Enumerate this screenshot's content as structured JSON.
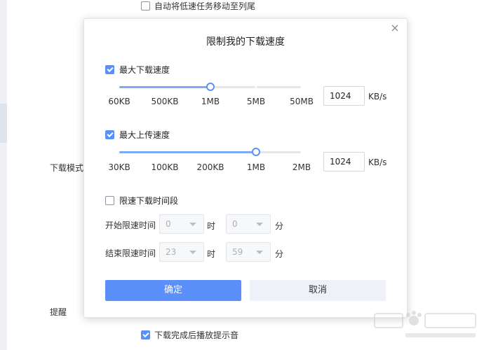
{
  "background": {
    "top_option": {
      "label": "自动将低速任务移动至列尾",
      "checked": false
    },
    "download_mode_label": "下载模式",
    "reminder_label": "提醒",
    "bottom_option": {
      "label": "下载完成后播放提示音",
      "checked": true
    }
  },
  "dialog": {
    "title": "限制我的下载速度",
    "close_icon": "close-icon",
    "max_download": {
      "label": "最大下载速度",
      "checked": true,
      "ticks": [
        "60KB",
        "500KB",
        "1MB",
        "5MB",
        "50MB"
      ],
      "selected_tick": "1MB",
      "value": "1024",
      "unit": "KB/s"
    },
    "max_upload": {
      "label": "最大上传速度",
      "checked": true,
      "ticks": [
        "30KB",
        "100KB",
        "200KB",
        "1MB",
        "2MB"
      ],
      "selected_tick": "1MB",
      "value": "1024",
      "unit": "KB/s"
    },
    "time_limit": {
      "label": "限速下载时间段",
      "checked": false,
      "start": {
        "label": "开始限速时间",
        "hour": "0",
        "minute": "0"
      },
      "end": {
        "label": "结束限速时间",
        "hour": "23",
        "minute": "59"
      },
      "hour_unit": "时",
      "minute_unit": "分"
    },
    "confirm_label": "确定",
    "cancel_label": "取消"
  },
  "colors": {
    "accent": "#5b8ff9",
    "track_fill": "#7ea8f8",
    "track": "#e4e6ea"
  }
}
